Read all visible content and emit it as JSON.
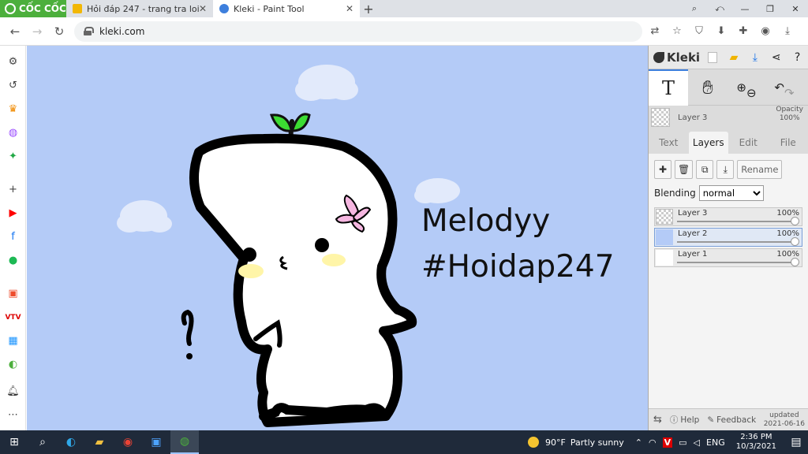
{
  "browser": {
    "brand": "CỐC CỐC",
    "tabs": [
      {
        "title": "Hỏi đáp 247 - trang tra loi",
        "active": false
      },
      {
        "title": "Kleki - Paint Tool",
        "active": true
      }
    ],
    "new_tab": "+",
    "url": "kleki.com"
  },
  "canvas": {
    "text_line1": "Melodyy",
    "text_line2": "#Hoidap247",
    "background": "#b4cbf7"
  },
  "kleki": {
    "logo": "Kleki",
    "current_layer": "Layer 3",
    "opacity_label": "Opacity",
    "opacity_value": "100%",
    "tabs": [
      "Text",
      "Layers",
      "Edit",
      "File"
    ],
    "active_tab": "Layers",
    "rename_label": "Rename",
    "blending_label": "Blending",
    "blending_value": "normal",
    "layers": [
      {
        "name": "Layer 3",
        "opacity": "100%",
        "selected": false
      },
      {
        "name": "Layer 2",
        "opacity": "100%",
        "selected": true
      },
      {
        "name": "Layer 1",
        "opacity": "100%",
        "selected": false
      }
    ],
    "help_label": "Help",
    "feedback_label": "Feedback",
    "updated_label": "updated",
    "updated_date": "2021-06-16"
  },
  "taskbar": {
    "weather_temp": "90°F",
    "weather_desc": "Partly sunny",
    "language": "ENG",
    "time": "2:36 PM",
    "date": "10/3/2021"
  },
  "colors": {
    "brand_green": "#4caf3c",
    "accent_blue": "#3d7fdd",
    "taskbar": "#1f2a3a"
  }
}
